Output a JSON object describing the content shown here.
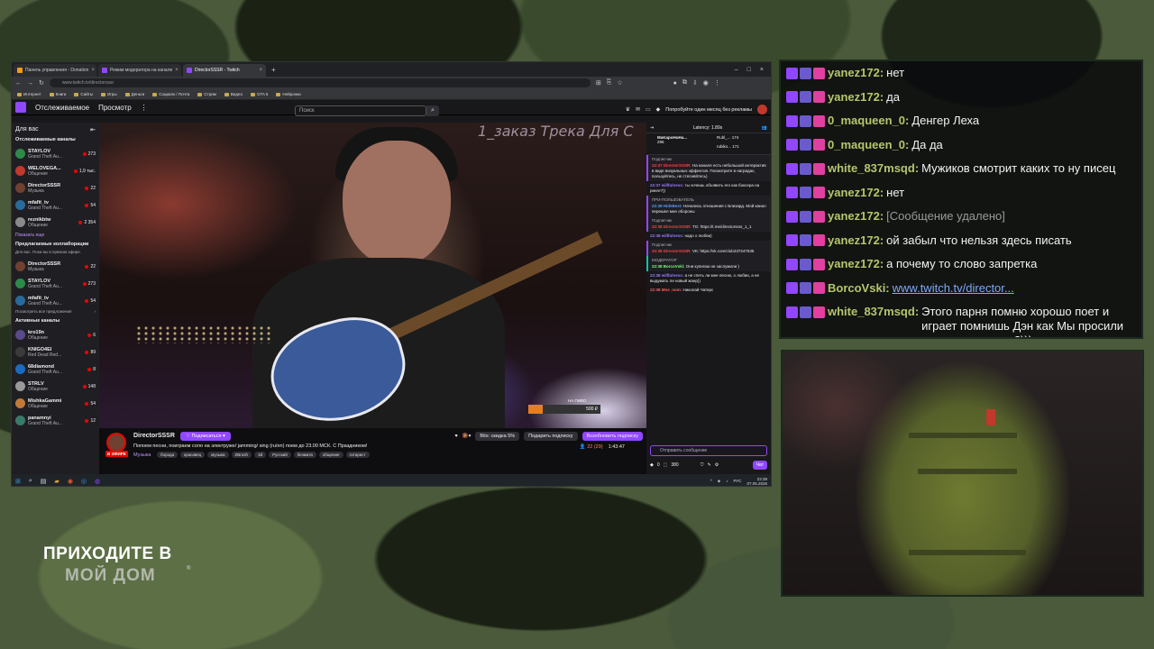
{
  "browser": {
    "tabs": [
      {
        "label": "Панель управления - Donation",
        "color": "#f39c12",
        "active": false
      },
      {
        "label": "Режим модератора на канале",
        "color": "#9147ff",
        "active": false
      },
      {
        "label": "DirectorSSSR - Twitch",
        "color": "#9147ff",
        "active": true
      }
    ],
    "new_tab": "+",
    "url": "www.twitch.tv/directorsssr",
    "bookmarks": [
      "Интернет",
      "Книги",
      "Сайты",
      "Игры",
      "Деньги",
      "Социалк / Почта",
      "Стрим",
      "Видео",
      "GTA 5",
      "Нейронки"
    ]
  },
  "twitch_header": {
    "following": "Отслеживаемое",
    "browse": "Просмотр",
    "more": "⋮",
    "search_placeholder": "Поиск",
    "promo": "Попробуйте один месяц без рекламы"
  },
  "sidebar": {
    "title": "Для вас",
    "followed_title": "Отслеживаемые каналы",
    "followed": [
      {
        "name": "STAYLOV",
        "game": "Grand Theft Au...",
        "count": "273",
        "color": "#2d8a4a"
      },
      {
        "name": "WELOVEGA...",
        "game": "Общение",
        "count": "1,9 тыс.",
        "color": "#c0392b"
      },
      {
        "name": "DirectorSSSR",
        "game": "Музыка",
        "count": "22",
        "color": "#704030"
      },
      {
        "name": "mfafit_tv",
        "game": "Grand Theft Au...",
        "count": "54",
        "color": "#2a6a9a"
      },
      {
        "name": "reznikbtw",
        "game": "Общение",
        "count": "2 354",
        "color": "#8a8a8a"
      }
    ],
    "show_more": "Показать еще",
    "collab_title": "Предлагаемые коллаборации",
    "collab_desc": "Для вас. Пока вы в прямом эфире.",
    "collab": [
      {
        "name": "DirectorSSSR",
        "game": "Музыка",
        "count": "22",
        "color": "#704030"
      },
      {
        "name": "STAYLOV",
        "game": "Grand Theft Au...",
        "count": "273",
        "color": "#2d8a4a"
      },
      {
        "name": "mfafit_tv",
        "game": "Grand Theft Au...",
        "count": "54",
        "color": "#2a6a9a"
      }
    ],
    "view_all": "Посмотреть все предложения",
    "active_title": "Активные каналы",
    "active": [
      {
        "name": "kro19n",
        "game": "Общение",
        "count": "6",
        "color": "#5a4a8a"
      },
      {
        "name": "KNIGO4EI",
        "game": "Red Dead Red...",
        "count": "89",
        "color": "#3a3a3a"
      },
      {
        "name": "68diamond",
        "game": "Grand Theft Au...",
        "count": "8",
        "color": "#1a6ac0"
      },
      {
        "name": "STRLV",
        "game": "Общение",
        "count": "148",
        "color": "#9a9a9a"
      },
      {
        "name": "MishkaGammi",
        "game": "Общение",
        "count": "54",
        "color": "#c07a3a"
      },
      {
        "name": "panamnyi",
        "game": "Grand Theft Au...",
        "count": "12",
        "color": "#3a7a6a"
      }
    ]
  },
  "video": {
    "overlay": "1_заказ Трека Для С",
    "donation_label": "НА ПИВО",
    "donation_amount": "500 ₽",
    "donation_progress": 0.2
  },
  "stream": {
    "channel": "DirectorSSSR",
    "live": "В ЭФИРЕ",
    "subscribe": "Подписаться",
    "title": "Попоем песни, поиграем соло на электруже/ jamming/ sing (ru/en) поем до 23.00 МСК. С Праздником!",
    "category": "Музыка",
    "tags": [
      "борода",
      "красавец",
      "музыка",
      "ZBrush",
      "3d",
      "Русский",
      "безмата",
      "общение",
      "гитарист"
    ],
    "bits": "Bits: скидка 5%",
    "gift_sub": "Подарить подписку",
    "resume_sub": "Возобновить подписку",
    "viewers": "22 (29)",
    "uptime": "1:43:47"
  },
  "twitch_chat": {
    "latency": "Latency: 1.89s",
    "gifters": [
      {
        "name": "MaKapoHuHa...",
        "count": "296"
      },
      {
        "name": "Rubl_...",
        "count": "174"
      },
      {
        "name": "rubiko...",
        "count": "171"
      }
    ],
    "messages": [
      {
        "head": "Подписчик",
        "user": "22:37 DirectorSSSR:",
        "text": "На канале есть небольшой интерактив в виде визуальных эффектов. Посмотрите в наградах, пользуйтесь, не стесняйтесь)",
        "style": "hl",
        "color": "#ff4040"
      },
      {
        "head": "",
        "user": "22:37 willfulness:",
        "text": "ты хочешь объявить его как боксера на ринге?))",
        "style": "",
        "color": "#9a7aff"
      },
      {
        "head": "ПРИ-ПОЛЬЗОВАТЕЛЬ",
        "user": "22:38 HideBest:",
        "text": "Начались отношения с Близард. Мой канал перешел мне обороны",
        "style": "hl",
        "color": "#5a9aff"
      },
      {
        "head": "Подписчик",
        "user": "22:38 DirectorSSSR:",
        "text": "TG: https://t.me/directorsssr_1_1",
        "style": "hl",
        "color": "#ff4040"
      },
      {
        "head": "",
        "user": "22:38 willfulness:",
        "text": "надо о любви)",
        "style": "",
        "color": "#9a7aff"
      },
      {
        "head": "Подписчик",
        "user": "22:38 DirectorSSSR:",
        "text": "VK: https://vk.com/club237247535",
        "style": "hl",
        "color": "#ff4040"
      },
      {
        "head": "МОДЕРАТОР",
        "user": "22:38 BorcoVski:",
        "text": "Они купигаю не заслужили )",
        "style": "hlg",
        "color": "#7aff7a"
      },
      {
        "head": "",
        "user": "22:38 willfulness:",
        "text": "а не спеть ли мне песню, о любви, а не выдумать ли новый жанр))",
        "style": "",
        "color": "#9a7aff"
      },
      {
        "head": "",
        "user": "22:38 Mne_nom:",
        "text": "Николай Чатерс",
        "style": "",
        "color": "#ff6060"
      }
    ],
    "input_placeholder": "Отправить сообщение",
    "points": "0",
    "channel_points": "380",
    "chat_button": "Чат"
  },
  "taskbar": {
    "lang": "РУС",
    "time": "22:39",
    "date": "07.05.2026"
  },
  "overlay_chat": [
    {
      "user": "yanez172:",
      "text": "нет",
      "color": "#b5c66a",
      "deleted": false,
      "link": false,
      "wrap": false
    },
    {
      "user": "yanez172:",
      "text": "да",
      "color": "#b5c66a",
      "deleted": false,
      "link": false,
      "wrap": false
    },
    {
      "user": "0_maqueen_0:",
      "text": "Денгер Леха",
      "color": "#b5c66a",
      "deleted": false,
      "link": false,
      "wrap": false
    },
    {
      "user": "0_maqueen_0:",
      "text": "Да да",
      "color": "#b5c66a",
      "deleted": false,
      "link": false,
      "wrap": false
    },
    {
      "user": "white_837msqd:",
      "text": "Мужиков смотрит каких то ну писец",
      "color": "#b5c66a",
      "deleted": false,
      "link": false,
      "wrap": false
    },
    {
      "user": "yanez172:",
      "text": "нет",
      "color": "#b5c66a",
      "deleted": false,
      "link": false,
      "wrap": false
    },
    {
      "user": "yanez172:",
      "text": "[Сообщение удалено]",
      "color": "#b5c66a",
      "deleted": true,
      "link": false,
      "wrap": false
    },
    {
      "user": "yanez172:",
      "text": "ой забыл что нельзя здесь писать",
      "color": "#b5c66a",
      "deleted": false,
      "link": false,
      "wrap": false
    },
    {
      "user": "yanez172:",
      "text": "а почему то слово запретка",
      "color": "#b5c66a",
      "deleted": false,
      "link": false,
      "wrap": false
    },
    {
      "user": "BorcoVski:",
      "text": "www.twitch.tv/director...",
      "color": "#b5c66a",
      "deleted": false,
      "link": true,
      "wrap": false
    },
    {
      "user": "white_837msqd:",
      "text": "Этого парня помню хорошо поет и играет помнишь Дэн как Мы просили его нам поиграть?)))",
      "color": "#b5c66a",
      "deleted": false,
      "link": false,
      "wrap": true
    }
  ],
  "promo": {
    "line1": "ПРИХОДИТЕ В",
    "line2": "МОЙ ДОМ",
    "mark": "®"
  },
  "colors": {
    "twitch_purple": "#9147ff",
    "live_red": "#eb0400",
    "overlay_user": "#b5c66a"
  }
}
